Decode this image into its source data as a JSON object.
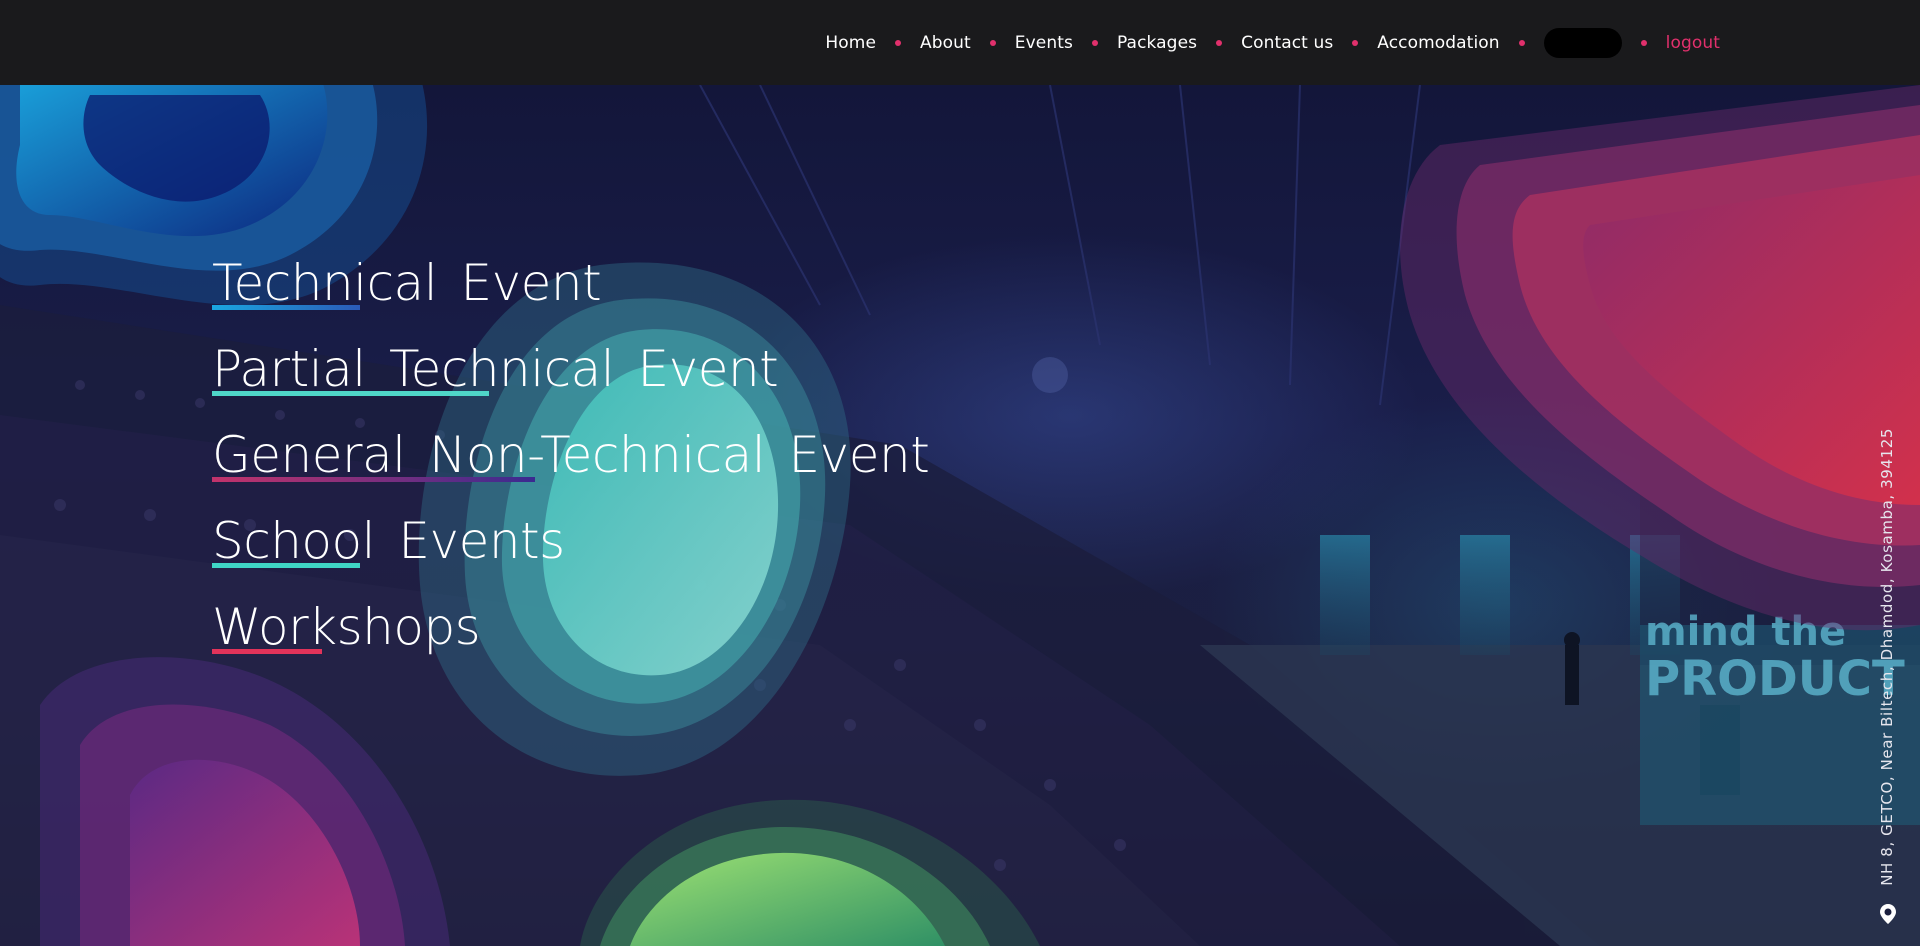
{
  "nav": {
    "items": [
      {
        "label": "Home"
      },
      {
        "label": "About"
      },
      {
        "label": "Events"
      },
      {
        "label": "Packages"
      },
      {
        "label": "Contact us"
      },
      {
        "label": "Accomodation"
      }
    ],
    "logout_label": "logout",
    "dot_color": "#e1306c"
  },
  "hero": {
    "events": [
      {
        "label": "Technical Event",
        "underline": [
          "#1aa7e0",
          "#2b5bb8"
        ],
        "underline_share": 0.38
      },
      {
        "label": "Partial Technical Event",
        "underline": [
          "#4fd6c8",
          "#4fd6c8"
        ],
        "underline_share": 0.49
      },
      {
        "label": "General Non-Technical Event",
        "underline": [
          "#c2336b",
          "#3a2a90"
        ],
        "underline_share": 0.45
      },
      {
        "label": "School Events",
        "underline": [
          "#3fd6c6",
          "#3fd6c6"
        ],
        "underline_share": 0.42
      },
      {
        "label": "Workshops",
        "underline": [
          "#e2335a",
          "#e2335a"
        ],
        "underline_share": 0.41
      }
    ],
    "address": "NH 8, GETCO, Near Biltech, Dhamdod, Kosamba, 394125",
    "stage_text": [
      "mind the",
      "PRODUCT"
    ],
    "icons": {
      "location": "location-pin-icon"
    }
  },
  "colors": {
    "accent_pink": "#e1306c",
    "navbar_bg": "#1a1a1c"
  }
}
